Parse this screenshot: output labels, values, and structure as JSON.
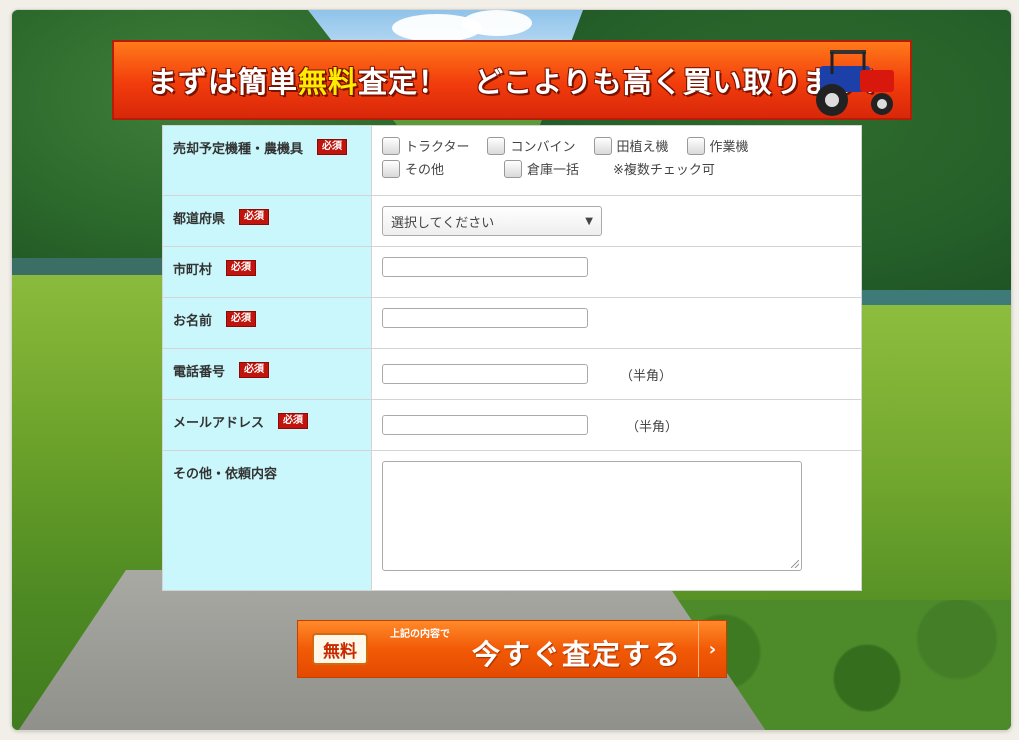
{
  "banner": {
    "text_before": "まずは簡単",
    "text_highlight": "無料",
    "text_after": "査定！",
    "text_second": "どこよりも高く買い取ります！"
  },
  "form": {
    "required_badge": "必須",
    "machine": {
      "label": "売却予定機種・農機具",
      "options": [
        "トラクター",
        "コンバイン",
        "田植え機",
        "作業機",
        "その他",
        "倉庫一括"
      ],
      "note": "※複数チェック可"
    },
    "prefecture": {
      "label": "都道府県",
      "placeholder": "選択してください"
    },
    "city": {
      "label": "市町村"
    },
    "name": {
      "label": "お名前"
    },
    "phone": {
      "label": "電話番号",
      "hint": "（半角）"
    },
    "email": {
      "label": "メールアドレス",
      "hint": "（半角）"
    },
    "other": {
      "label": "その他・依頼内容"
    }
  },
  "submit": {
    "badge": "無料",
    "sub_label": "上記の内容で",
    "label": "今すぐ査定する",
    "arrow": "›"
  }
}
